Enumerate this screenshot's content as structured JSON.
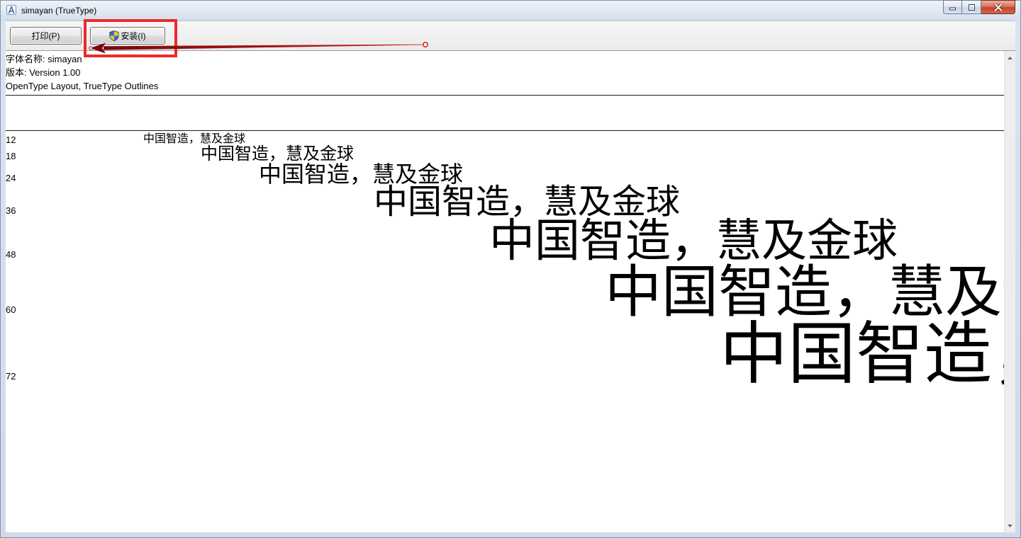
{
  "window": {
    "title": "simayan (TrueType)",
    "icon": "font-file-icon",
    "controls": [
      "minimize-icon",
      "maximize-icon",
      "close-icon"
    ]
  },
  "toolbar": {
    "print_label": "打印(P)",
    "install_label": "安装(I)",
    "install_icon": "uac-shield-icon"
  },
  "font_info": {
    "name": "字体名称: simayan",
    "version": "版本: Version 1.00",
    "outlines": "OpenType Layout, TrueType Outlines"
  },
  "preview": {
    "sample_text": "中国智造，慧及金球",
    "rows": [
      {
        "size": 12
      },
      {
        "size": 18
      },
      {
        "size": 24
      },
      {
        "size": 36
      },
      {
        "size": 48
      },
      {
        "size": 60
      },
      {
        "size": 72
      }
    ]
  },
  "scrollbar": {
    "up_icon": "scroll-up-arrow-icon",
    "down_icon": "scroll-down-arrow-icon"
  },
  "annotation": {
    "box_color": "#ee2a2a",
    "arrow_color": "#7a0808",
    "arrow_tail_color": "#c42020",
    "marker_color": "#e02020"
  }
}
